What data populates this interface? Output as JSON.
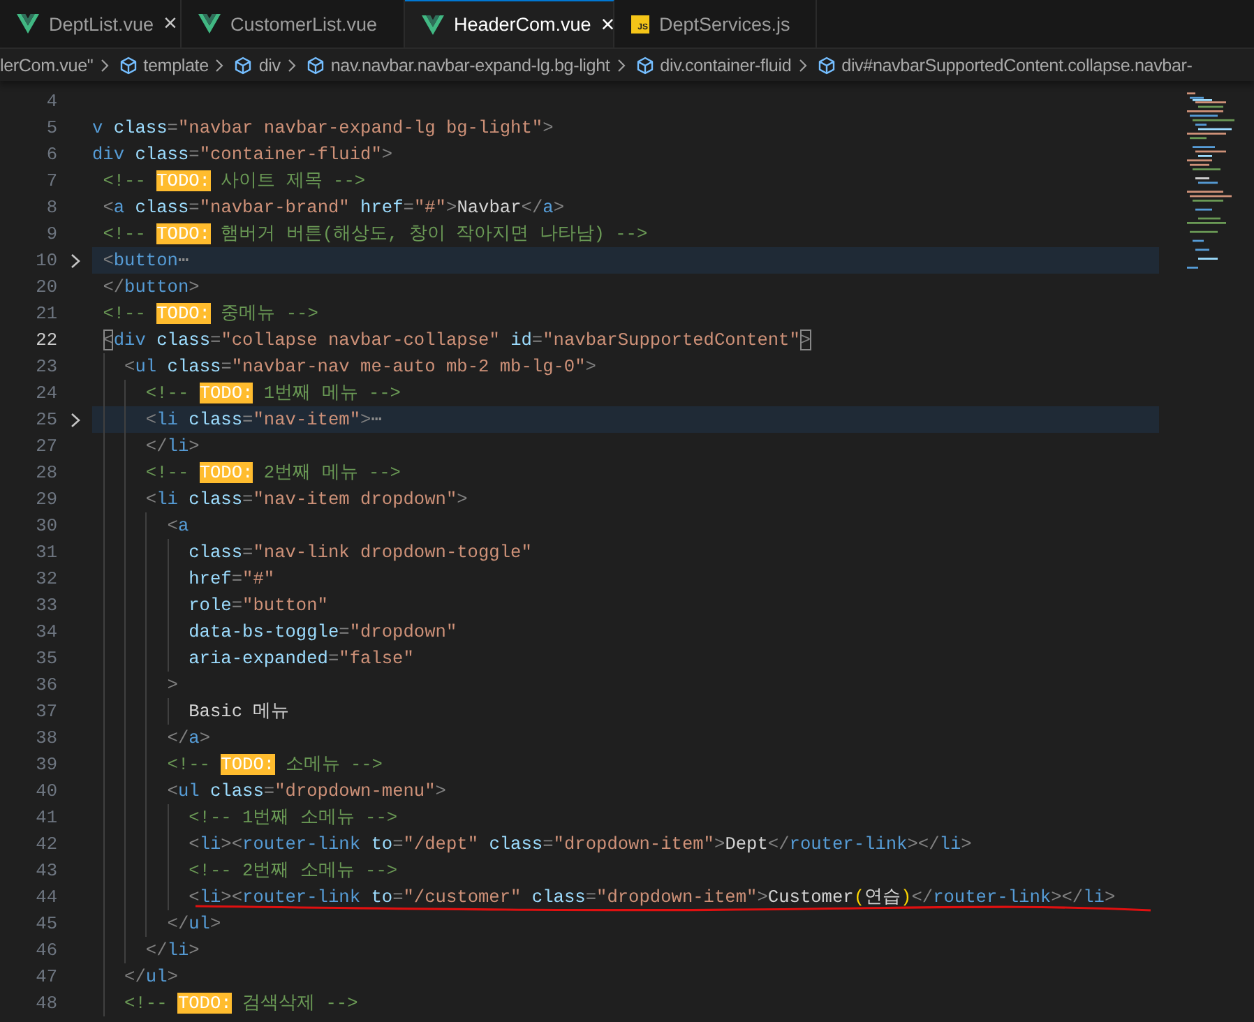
{
  "tabs": [
    {
      "label": "DeptList.vue",
      "kind": "vue",
      "selected": false,
      "close": "×"
    },
    {
      "label": "CustomerList.vue",
      "kind": "vue",
      "selected": false
    },
    {
      "label": "HeaderCom.vue",
      "kind": "vue",
      "selected": true,
      "close": "×"
    },
    {
      "label": "DeptServices.js",
      "kind": "js",
      "icon_text": "JS",
      "selected": false
    }
  ],
  "breadcrumb": [
    {
      "text": "lerCom.vue\"",
      "kind": "file"
    },
    {
      "text": "template",
      "kind": "symbol"
    },
    {
      "text": "div",
      "kind": "symbol"
    },
    {
      "text": "nav.navbar.navbar-expand-lg.bg-light",
      "kind": "symbol"
    },
    {
      "text": "div.container-fluid",
      "kind": "symbol"
    },
    {
      "text": "div#navbarSupportedContent.collapse.navbar-",
      "kind": "symbol"
    }
  ],
  "lines": [
    {
      "number": "4",
      "folded": false,
      "current": false,
      "underlined": false
    },
    {
      "number": "5",
      "folded": false,
      "current": false,
      "underlined": false,
      "tokens": [
        {
          "kind": "tag",
          "text": "v"
        },
        {
          "kind": "attr",
          "text": " class"
        },
        {
          "kind": "punct",
          "text": "="
        },
        {
          "kind": "string",
          "text": "\"navbar navbar-expand-lg bg-light\""
        },
        {
          "kind": "punct",
          "text": ">"
        }
      ]
    },
    {
      "number": "6",
      "folded": false,
      "current": false,
      "underlined": false,
      "tokens": [
        {
          "kind": "tag",
          "text": "div"
        },
        {
          "kind": "attr",
          "text": " class"
        },
        {
          "kind": "punct",
          "text": "="
        },
        {
          "kind": "string",
          "text": "\"container-fluid\""
        },
        {
          "kind": "punct",
          "text": ">"
        }
      ]
    },
    {
      "number": "7",
      "folded": false,
      "current": false,
      "underlined": false,
      "tokens": [
        {
          "kind": "comment",
          "text": " <!-- "
        },
        {
          "kind": "todo",
          "text": "TODO:"
        },
        {
          "kind": "comment",
          "text": " 사이트 제목 -->"
        }
      ]
    },
    {
      "number": "8",
      "folded": false,
      "current": false,
      "underlined": false,
      "tokens": [
        {
          "kind": "punct",
          "text": " <"
        },
        {
          "kind": "tag",
          "text": "a"
        },
        {
          "kind": "attr",
          "text": " class"
        },
        {
          "kind": "punct",
          "text": "="
        },
        {
          "kind": "string",
          "text": "\"navbar-brand\""
        },
        {
          "kind": "attr",
          "text": " href"
        },
        {
          "kind": "punct",
          "text": "="
        },
        {
          "kind": "string",
          "text": "\"#\""
        },
        {
          "kind": "punct",
          "text": ">"
        },
        {
          "kind": "text",
          "text": "Navbar"
        },
        {
          "kind": "punct",
          "text": "</"
        },
        {
          "kind": "tag",
          "text": "a"
        },
        {
          "kind": "punct",
          "text": ">"
        }
      ]
    },
    {
      "number": "9",
      "folded": false,
      "current": false,
      "underlined": false,
      "tokens": [
        {
          "kind": "comment",
          "text": " <!-- "
        },
        {
          "kind": "todo",
          "text": "TODO:"
        },
        {
          "kind": "comment",
          "text": " 햄버거 버튼(해상도, 창이 작아지면 나타남) -->"
        }
      ]
    },
    {
      "number": "10",
      "folded": true,
      "current": false,
      "underlined": false,
      "tokens": [
        {
          "kind": "punct",
          "text": " <"
        },
        {
          "kind": "tag",
          "text": "button"
        },
        {
          "kind": "ellipsis",
          "text": "⋯"
        }
      ]
    },
    {
      "number": "20",
      "folded": false,
      "current": false,
      "underlined": false,
      "tokens": [
        {
          "kind": "punct",
          "text": " </"
        },
        {
          "kind": "tag",
          "text": "button"
        },
        {
          "kind": "punct",
          "text": ">"
        }
      ]
    },
    {
      "number": "21",
      "folded": false,
      "current": false,
      "underlined": false,
      "tokens": [
        {
          "kind": "comment",
          "text": " <!-- "
        },
        {
          "kind": "todo",
          "text": "TODO:"
        },
        {
          "kind": "comment",
          "text": " 중메뉴 -->"
        }
      ]
    },
    {
      "number": "22",
      "folded": false,
      "current": true,
      "underlined": false,
      "tokens": [
        {
          "kind": "match",
          "text": " <"
        },
        {
          "kind": "tag",
          "text": "div"
        },
        {
          "kind": "attr",
          "text": " class"
        },
        {
          "kind": "punct",
          "text": "="
        },
        {
          "kind": "string",
          "text": "\"collapse navbar-collapse\""
        },
        {
          "kind": "attr",
          "text": " id"
        },
        {
          "kind": "punct",
          "text": "="
        },
        {
          "kind": "string",
          "text": "\"navbarSupportedContent\""
        },
        {
          "kind": "match",
          "text": ">"
        }
      ]
    },
    {
      "number": "23",
      "folded": false,
      "current": false,
      "underlined": false,
      "tokens": [
        {
          "kind": "punct",
          "text": "   <"
        },
        {
          "kind": "tag",
          "text": "ul"
        },
        {
          "kind": "attr",
          "text": " class"
        },
        {
          "kind": "punct",
          "text": "="
        },
        {
          "kind": "string",
          "text": "\"navbar-nav me-auto mb-2 mb-lg-0\""
        },
        {
          "kind": "punct",
          "text": ">"
        }
      ]
    },
    {
      "number": "24",
      "folded": false,
      "current": false,
      "underlined": false,
      "tokens": [
        {
          "kind": "comment",
          "text": "     <!-- "
        },
        {
          "kind": "todo",
          "text": "TODO:"
        },
        {
          "kind": "comment",
          "text": " 1번째 메뉴 -->"
        }
      ]
    },
    {
      "number": "25",
      "folded": true,
      "current": false,
      "underlined": false,
      "tokens": [
        {
          "kind": "punct",
          "text": "     <"
        },
        {
          "kind": "tag",
          "text": "li"
        },
        {
          "kind": "attr",
          "text": " class"
        },
        {
          "kind": "punct",
          "text": "="
        },
        {
          "kind": "string",
          "text": "\"nav-item\""
        },
        {
          "kind": "punct",
          "text": ">"
        },
        {
          "kind": "ellipsis",
          "text": "⋯"
        }
      ]
    },
    {
      "number": "27",
      "folded": false,
      "current": false,
      "underlined": false,
      "tokens": [
        {
          "kind": "punct",
          "text": "     </"
        },
        {
          "kind": "tag",
          "text": "li"
        },
        {
          "kind": "punct",
          "text": ">"
        }
      ]
    },
    {
      "number": "28",
      "folded": false,
      "current": false,
      "underlined": false,
      "tokens": [
        {
          "kind": "comment",
          "text": "     <!-- "
        },
        {
          "kind": "todo",
          "text": "TODO:"
        },
        {
          "kind": "comment",
          "text": " 2번째 메뉴 -->"
        }
      ]
    },
    {
      "number": "29",
      "folded": false,
      "current": false,
      "underlined": false,
      "tokens": [
        {
          "kind": "punct",
          "text": "     <"
        },
        {
          "kind": "tag",
          "text": "li"
        },
        {
          "kind": "attr",
          "text": " class"
        },
        {
          "kind": "punct",
          "text": "="
        },
        {
          "kind": "string",
          "text": "\"nav-item dropdown\""
        },
        {
          "kind": "punct",
          "text": ">"
        }
      ]
    },
    {
      "number": "30",
      "folded": false,
      "current": false,
      "underlined": false,
      "tokens": [
        {
          "kind": "punct",
          "text": "       <"
        },
        {
          "kind": "tag",
          "text": "a"
        }
      ]
    },
    {
      "number": "31",
      "folded": false,
      "current": false,
      "underlined": false,
      "tokens": [
        {
          "kind": "attr",
          "text": "         class"
        },
        {
          "kind": "punct",
          "text": "="
        },
        {
          "kind": "string",
          "text": "\"nav-link dropdown-toggle\""
        }
      ]
    },
    {
      "number": "32",
      "folded": false,
      "current": false,
      "underlined": false,
      "tokens": [
        {
          "kind": "attr",
          "text": "         href"
        },
        {
          "kind": "punct",
          "text": "="
        },
        {
          "kind": "string",
          "text": "\"#\""
        }
      ]
    },
    {
      "number": "33",
      "folded": false,
      "current": false,
      "underlined": false,
      "tokens": [
        {
          "kind": "attr",
          "text": "         role"
        },
        {
          "kind": "punct",
          "text": "="
        },
        {
          "kind": "string",
          "text": "\"button\""
        }
      ]
    },
    {
      "number": "34",
      "folded": false,
      "current": false,
      "underlined": false,
      "tokens": [
        {
          "kind": "attr",
          "text": "         data-bs-toggle"
        },
        {
          "kind": "punct",
          "text": "="
        },
        {
          "kind": "string",
          "text": "\"dropdown\""
        }
      ]
    },
    {
      "number": "35",
      "folded": false,
      "current": false,
      "underlined": false,
      "tokens": [
        {
          "kind": "attr",
          "text": "         aria-expanded"
        },
        {
          "kind": "punct",
          "text": "="
        },
        {
          "kind": "string",
          "text": "\"false\""
        }
      ]
    },
    {
      "number": "36",
      "folded": false,
      "current": false,
      "underlined": false,
      "tokens": [
        {
          "kind": "punct",
          "text": "       >"
        }
      ]
    },
    {
      "number": "37",
      "folded": false,
      "current": false,
      "underlined": false,
      "tokens": [
        {
          "kind": "text",
          "text": "         Basic 메뉴"
        }
      ]
    },
    {
      "number": "38",
      "folded": false,
      "current": false,
      "underlined": false,
      "tokens": [
        {
          "kind": "punct",
          "text": "       </"
        },
        {
          "kind": "tag",
          "text": "a"
        },
        {
          "kind": "punct",
          "text": ">"
        }
      ]
    },
    {
      "number": "39",
      "folded": false,
      "current": false,
      "underlined": false,
      "tokens": [
        {
          "kind": "comment",
          "text": "       <!-- "
        },
        {
          "kind": "todo",
          "text": "TODO:"
        },
        {
          "kind": "comment",
          "text": " 소메뉴 -->"
        }
      ]
    },
    {
      "number": "40",
      "folded": false,
      "current": false,
      "underlined": false,
      "tokens": [
        {
          "kind": "punct",
          "text": "       <"
        },
        {
          "kind": "tag",
          "text": "ul"
        },
        {
          "kind": "attr",
          "text": " class"
        },
        {
          "kind": "punct",
          "text": "="
        },
        {
          "kind": "string",
          "text": "\"dropdown-menu\""
        },
        {
          "kind": "punct",
          "text": ">"
        }
      ]
    },
    {
      "number": "41",
      "folded": false,
      "current": false,
      "underlined": false,
      "tokens": [
        {
          "kind": "comment",
          "text": "         <!-- 1번째 소메뉴 -->"
        }
      ]
    },
    {
      "number": "42",
      "folded": false,
      "current": false,
      "underlined": false,
      "tokens": [
        {
          "kind": "punct",
          "text": "         <"
        },
        {
          "kind": "tag",
          "text": "li"
        },
        {
          "kind": "punct",
          "text": "><"
        },
        {
          "kind": "tag",
          "text": "router-link"
        },
        {
          "kind": "attr",
          "text": " to"
        },
        {
          "kind": "punct",
          "text": "="
        },
        {
          "kind": "string",
          "text": "\"/dept\""
        },
        {
          "kind": "attr",
          "text": " class"
        },
        {
          "kind": "punct",
          "text": "="
        },
        {
          "kind": "string",
          "text": "\"dropdown-item\""
        },
        {
          "kind": "punct",
          "text": ">"
        },
        {
          "kind": "text",
          "text": "Dept"
        },
        {
          "kind": "punct",
          "text": "</"
        },
        {
          "kind": "tag",
          "text": "router-link"
        },
        {
          "kind": "punct",
          "text": "></"
        },
        {
          "kind": "tag",
          "text": "li"
        },
        {
          "kind": "punct",
          "text": ">"
        }
      ]
    },
    {
      "number": "43",
      "folded": false,
      "current": false,
      "underlined": false,
      "tokens": [
        {
          "kind": "comment",
          "text": "         <!-- 2번째 소메뉴 -->"
        }
      ]
    },
    {
      "number": "44",
      "folded": false,
      "current": false,
      "underlined": true,
      "tokens": [
        {
          "kind": "punct",
          "text": "         <"
        },
        {
          "kind": "tag",
          "text": "li"
        },
        {
          "kind": "punct",
          "text": "><"
        },
        {
          "kind": "tag",
          "text": "router-link"
        },
        {
          "kind": "attr",
          "text": " to"
        },
        {
          "kind": "punct",
          "text": "="
        },
        {
          "kind": "string",
          "text": "\"/customer\""
        },
        {
          "kind": "attr",
          "text": " class"
        },
        {
          "kind": "punct",
          "text": "="
        },
        {
          "kind": "string",
          "text": "\"dropdown-item\""
        },
        {
          "kind": "punct",
          "text": ">"
        },
        {
          "kind": "text",
          "text": "Customer"
        },
        {
          "kind": "bracket",
          "text": "("
        },
        {
          "kind": "text",
          "text": "연습"
        },
        {
          "kind": "bracket",
          "text": ")"
        },
        {
          "kind": "punct",
          "text": "</"
        },
        {
          "kind": "tag",
          "text": "router-link"
        },
        {
          "kind": "punct",
          "text": "></"
        },
        {
          "kind": "tag",
          "text": "li"
        },
        {
          "kind": "punct",
          "text": ">"
        }
      ]
    },
    {
      "number": "45",
      "folded": false,
      "current": false,
      "underlined": false,
      "tokens": [
        {
          "kind": "punct",
          "text": "       </"
        },
        {
          "kind": "tag",
          "text": "ul"
        },
        {
          "kind": "punct",
          "text": ">"
        }
      ]
    },
    {
      "number": "46",
      "folded": false,
      "current": false,
      "underlined": false,
      "tokens": [
        {
          "kind": "punct",
          "text": "     </"
        },
        {
          "kind": "tag",
          "text": "li"
        },
        {
          "kind": "punct",
          "text": ">"
        }
      ]
    },
    {
      "number": "47",
      "folded": false,
      "current": false,
      "underlined": false,
      "tokens": [
        {
          "kind": "punct",
          "text": "   </"
        },
        {
          "kind": "tag",
          "text": "ul"
        },
        {
          "kind": "punct",
          "text": ">"
        }
      ]
    },
    {
      "number": "48",
      "folded": false,
      "current": false,
      "underlined": false,
      "tokens": [
        {
          "kind": "comment",
          "text": "   <!-- "
        },
        {
          "kind": "todo",
          "text": "TODO:"
        },
        {
          "kind": "comment",
          "text": " 검색삭제 -->"
        }
      ]
    }
  ]
}
